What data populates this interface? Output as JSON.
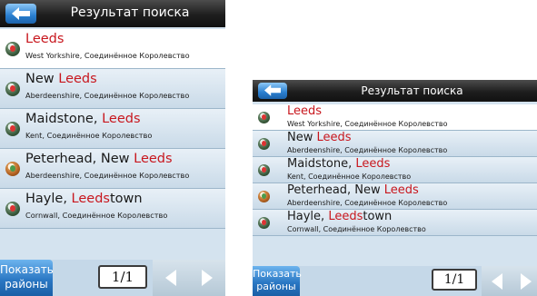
{
  "header": {
    "title": "Результат поиска"
  },
  "results": [
    {
      "prefix": "",
      "highlight": "Leeds",
      "suffix": "",
      "region": "West Yorkshire, Соединённое Королевство",
      "pin": "red"
    },
    {
      "prefix": "New ",
      "highlight": "Leeds",
      "suffix": "",
      "region": "Aberdeenshire, Соединённое Королевство",
      "pin": "red"
    },
    {
      "prefix": "Maidstone, ",
      "highlight": "Leeds",
      "suffix": "",
      "region": "Kent, Соединённое Королевство",
      "pin": "red"
    },
    {
      "prefix": "Peterhead, New ",
      "highlight": "Leeds",
      "suffix": "",
      "region": "Aberdeenshire, Соединённое Королевство",
      "pin": "orange"
    },
    {
      "prefix": "Hayle, ",
      "highlight": "Leeds",
      "suffix": "town",
      "region": "Cornwall, Соединённое Королевство",
      "pin": "red"
    }
  ],
  "footer": {
    "show_line1": "Показать",
    "show_line2": "районы",
    "page": "1/1"
  },
  "colors": {
    "highlight": "#c8171e",
    "header_bg": "#1e1e1e",
    "list_bg": "#d4e3ef",
    "button_blue": "#2b78c4"
  },
  "icons": {
    "back": "arrow-left-icon",
    "pin": "map-pin-icon",
    "prev": "chevron-left-icon",
    "next": "chevron-right-icon"
  }
}
